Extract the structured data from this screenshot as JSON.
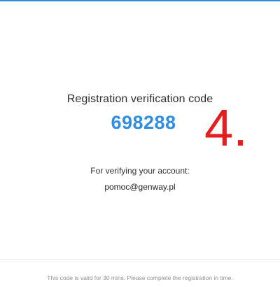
{
  "email": {
    "heading": "Registration verification code",
    "code": "698288",
    "purpose_label": "For verifying your account:",
    "account": "pomoc@genway.pl",
    "footer_note": "This code is valid for 30 mins. Please complete the registration in time."
  },
  "overlay": {
    "step_number": "4."
  },
  "colors": {
    "accent_blue": "#2f8ee0",
    "top_rule": "#2e8fd8",
    "overlay_red": "#e41e1e"
  }
}
